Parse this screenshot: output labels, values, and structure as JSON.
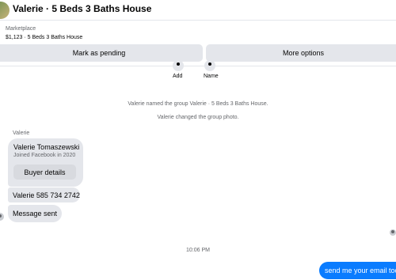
{
  "header": {
    "title": "Valerie · 5 Beds 3 Baths House"
  },
  "listing": {
    "label": "Marketplace",
    "item": "$1,123 · 5 Beds 3 Baths House"
  },
  "actions": {
    "pending": "Mark as pending",
    "more": "More options"
  },
  "group_actions": {
    "add": "Add",
    "name": "Name"
  },
  "system": {
    "named": "Valerie named the group Valerie · 5 Beds 3 Baths House.",
    "photo": "Valerie changed the group photo."
  },
  "messages": {
    "sender": "Valerie",
    "card": {
      "name": "Valerie Tomaszewski",
      "joined": "Joined Facebook in 2020",
      "button": "Buyer details"
    },
    "phone": "Valerie 585 734 2742",
    "sent_note": "Message sent",
    "timestamp": "10:06 PM",
    "outgoing": "send me your email too"
  }
}
